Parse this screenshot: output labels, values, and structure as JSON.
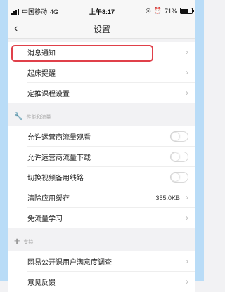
{
  "status": {
    "carrier": "中国移动",
    "network": "4G",
    "time": "上午8:17",
    "battery": "71%",
    "battery_level": 0.71
  },
  "nav": {
    "back_icon": "chevron-left-icon",
    "title": "设置"
  },
  "groups": {
    "top": [
      {
        "label": "消息通知"
      },
      {
        "label": "起床提醒"
      },
      {
        "label": "定推课程设置"
      }
    ],
    "performance_header": "性能和流量",
    "performance": [
      {
        "label": "允许运营商流量观看",
        "toggle": false
      },
      {
        "label": "允许运营商流量下载",
        "toggle": false
      },
      {
        "label": "切换视频备用线路",
        "toggle": false
      },
      {
        "label": "清除应用缓存",
        "value": "355.0KB"
      },
      {
        "label": "免流量学习"
      }
    ],
    "support_header": "支持",
    "support": [
      {
        "label": "网易公开课用户满意度调查"
      },
      {
        "label": "意见反馈"
      }
    ]
  },
  "colors": {
    "highlight": "#e0404a",
    "frame": "#b9dcf7"
  }
}
